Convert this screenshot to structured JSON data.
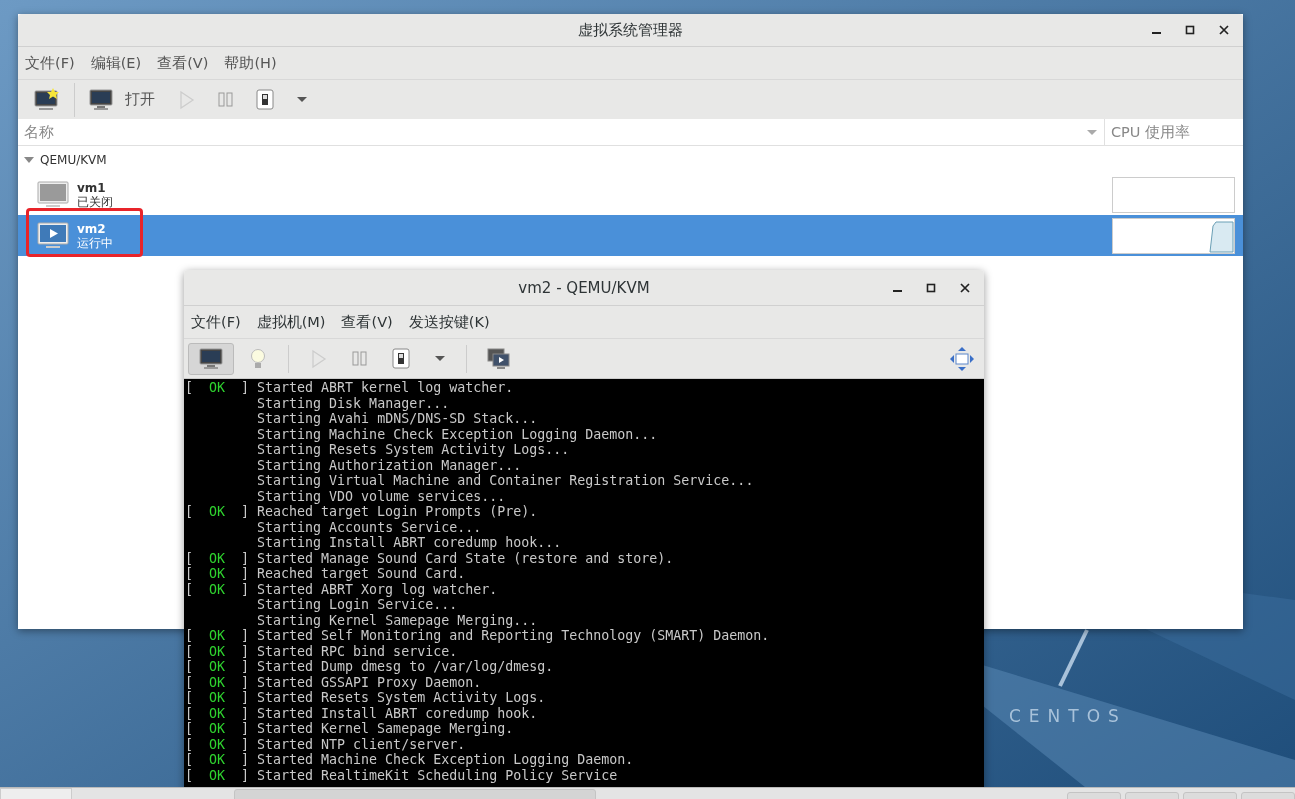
{
  "desktop": {
    "wallpaper_text": "CENTOS"
  },
  "manager": {
    "title": "虚拟系统管理器",
    "menu": [
      "文件(F)",
      "编辑(E)",
      "查看(V)",
      "帮助(H)"
    ],
    "toolbar": [
      {
        "kind": "new",
        "disabled": false
      },
      {
        "kind": "open",
        "label": "打开",
        "disabled": false
      },
      {
        "kind": "run",
        "disabled": true
      },
      {
        "kind": "pause",
        "disabled": false
      },
      {
        "kind": "power",
        "disabled": false
      },
      {
        "kind": "dropdown",
        "disabled": false
      }
    ],
    "columns": [
      "名称",
      "CPU 使用率"
    ],
    "group": {
      "label": "QEMU/KVM",
      "expanded": true,
      "vms": [
        {
          "name": "vm1",
          "status": "已关闭",
          "running": false,
          "selected": false,
          "highlighted": false
        },
        {
          "name": "vm2",
          "status": "运行中",
          "running": true,
          "selected": true,
          "highlighted": true
        }
      ]
    }
  },
  "console_window": {
    "title": "vm2 - QEMU/KVM",
    "menu": [
      "文件(F)",
      "虚拟机(M)",
      "查看(V)",
      "发送按键(K)"
    ],
    "toolbar": [
      {
        "kind": "display",
        "selected": true
      },
      {
        "kind": "details",
        "selected": false
      },
      {
        "kind": "run",
        "selected": false
      },
      {
        "kind": "pause",
        "selected": false
      },
      {
        "kind": "power",
        "selected": false
      },
      {
        "kind": "dropdown",
        "selected": false
      },
      {
        "kind": "snapshots",
        "selected": false
      },
      {
        "kind": "fullscreen",
        "selected": false
      }
    ],
    "console": [
      {
        "open": "[",
        "status": "OK",
        "close": "]",
        "text": "Started ABRT kernel log watcher."
      },
      {
        "text": "Starting Disk Manager..."
      },
      {
        "text": "Starting Avahi mDNS/DNS-SD Stack..."
      },
      {
        "text": "Starting Machine Check Exception Logging Daemon..."
      },
      {
        "text": "Starting Resets System Activity Logs..."
      },
      {
        "text": "Starting Authorization Manager..."
      },
      {
        "text": "Starting Virtual Machine and Container Registration Service..."
      },
      {
        "text": "Starting VDO volume services..."
      },
      {
        "open": "[",
        "status": "OK",
        "close": "]",
        "text": "Reached target Login Prompts (Pre)."
      },
      {
        "text": "Starting Accounts Service..."
      },
      {
        "text": "Starting Install ABRT coredump hook..."
      },
      {
        "open": "[",
        "status": "OK",
        "close": "]",
        "text": "Started Manage Sound Card State (restore and store)."
      },
      {
        "open": "[",
        "status": "OK",
        "close": "]",
        "text": "Reached target Sound Card."
      },
      {
        "open": "[",
        "status": "OK",
        "close": "]",
        "text": "Started ABRT Xorg log watcher."
      },
      {
        "text": "Starting Login Service..."
      },
      {
        "text": "Starting Kernel Samepage Merging..."
      },
      {
        "open": "[",
        "status": "OK",
        "close": "]",
        "text": "Started Self Monitoring and Reporting Technology (SMART) Daemon."
      },
      {
        "open": "[",
        "status": "OK",
        "close": "]",
        "text": "Started RPC bind service."
      },
      {
        "open": "[",
        "status": "OK",
        "close": "]",
        "text": "Started Dump dmesg to /var/log/dmesg."
      },
      {
        "open": "[",
        "status": "OK",
        "close": "]",
        "text": "Started GSSAPI Proxy Daemon."
      },
      {
        "open": "[",
        "status": "OK",
        "close": "]",
        "text": "Started Resets System Activity Logs."
      },
      {
        "open": "[",
        "status": "OK",
        "close": "]",
        "text": "Started Install ABRT coredump hook."
      },
      {
        "open": "[",
        "status": "OK",
        "close": "]",
        "text": "Started Kernel Samepage Merging."
      },
      {
        "open": "[",
        "status": "OK",
        "close": "]",
        "text": "Started NTP client/server."
      },
      {
        "open": "[",
        "status": "OK",
        "close": "]",
        "text": "Started Machine Check Exception Logging Daemon."
      },
      {
        "open": "[",
        "status": "OK",
        "close": "]",
        "text": "Started RealtimeKit Scheduling Policy Service"
      }
    ]
  }
}
